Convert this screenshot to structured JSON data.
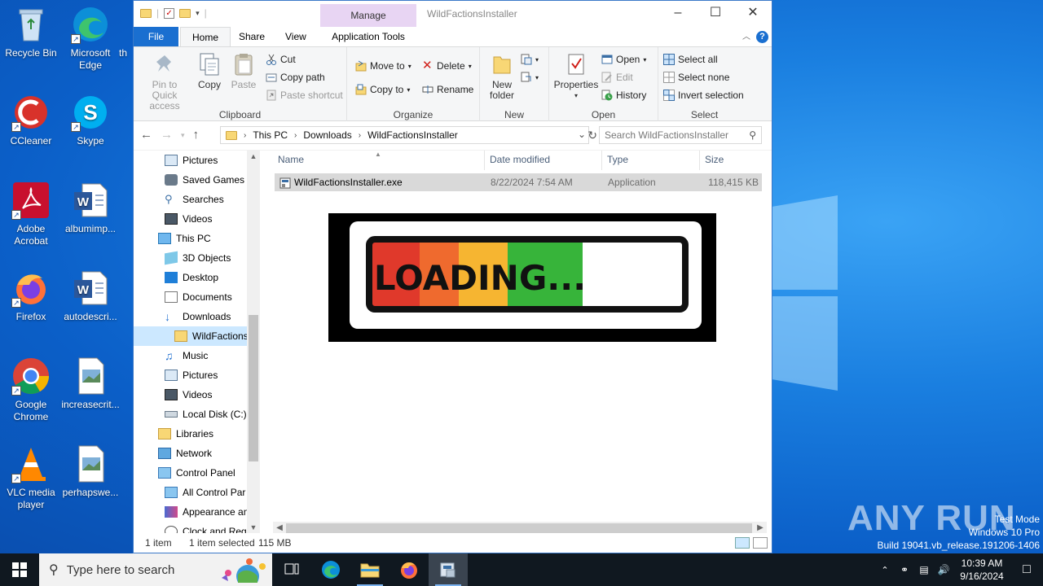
{
  "desktop": {
    "icons": [
      {
        "label": "Recycle Bin",
        "icon": "recycle-bin-icon"
      },
      {
        "label": "Microsoft Edge",
        "icon": "edge-icon"
      },
      {
        "label": "th",
        "icon": "generic-icon"
      },
      {
        "label": "CCleaner",
        "icon": "ccleaner-icon"
      },
      {
        "label": "Skype",
        "icon": "skype-icon"
      },
      {
        "label": "Adobe Acrobat",
        "icon": "acrobat-icon"
      },
      {
        "label": "albumimp...",
        "icon": "word-doc-icon"
      },
      {
        "label": "Firefox",
        "icon": "firefox-icon"
      },
      {
        "label": "autodescri...",
        "icon": "word-doc-icon"
      },
      {
        "label": "Google Chrome",
        "icon": "chrome-icon"
      },
      {
        "label": "increasecrit...",
        "icon": "image-file-icon"
      },
      {
        "label": "VLC media player",
        "icon": "vlc-icon"
      },
      {
        "label": "perhapswe...",
        "icon": "image-file-icon"
      }
    ],
    "watermark": "ANY RUN",
    "test_mode": {
      "line1": "Test Mode",
      "line2": "Windows 10 Pro",
      "line3": "Build 19041.vb_release.191206-1406"
    }
  },
  "window": {
    "title": "WildFactionsInstaller",
    "manage_tab": "Manage",
    "tabs": {
      "file": "File",
      "home": "Home",
      "share": "Share",
      "view": "View",
      "app_tools": "Application Tools"
    },
    "ribbon": {
      "clipboard": {
        "label": "Clipboard",
        "pin": "Pin to Quick access",
        "copy": "Copy",
        "paste": "Paste",
        "cut": "Cut",
        "copy_path": "Copy path",
        "paste_shortcut": "Paste shortcut"
      },
      "organize": {
        "label": "Organize",
        "move_to": "Move to",
        "copy_to": "Copy to",
        "delete": "Delete",
        "rename": "Rename"
      },
      "new": {
        "label": "New",
        "new_folder": "New folder"
      },
      "open": {
        "label": "Open",
        "properties": "Properties",
        "open": "Open",
        "edit": "Edit",
        "history": "History"
      },
      "select": {
        "label": "Select",
        "select_all": "Select all",
        "select_none": "Select none",
        "invert": "Invert selection"
      }
    },
    "address": {
      "crumbs": [
        "This PC",
        "Downloads",
        "WildFactionsInstaller"
      ],
      "search_placeholder": "Search WildFactionsInstaller"
    },
    "nav": [
      {
        "label": "Pictures",
        "icon": "pictures-icon"
      },
      {
        "label": "Saved Games",
        "icon": "saved-games-icon"
      },
      {
        "label": "Searches",
        "icon": "searches-icon"
      },
      {
        "label": "Videos",
        "icon": "videos-icon"
      },
      {
        "label": "This PC",
        "icon": "this-pc-icon"
      },
      {
        "label": "3D Objects",
        "icon": "3d-objects-icon"
      },
      {
        "label": "Desktop",
        "icon": "desktop-icon"
      },
      {
        "label": "Documents",
        "icon": "documents-icon"
      },
      {
        "label": "Downloads",
        "icon": "downloads-icon"
      },
      {
        "label": "WildFactionsI",
        "icon": "folder-icon"
      },
      {
        "label": "Music",
        "icon": "music-icon"
      },
      {
        "label": "Pictures",
        "icon": "pictures-icon"
      },
      {
        "label": "Videos",
        "icon": "videos-icon"
      },
      {
        "label": "Local Disk (C:)",
        "icon": "disk-icon"
      },
      {
        "label": "Libraries",
        "icon": "libraries-icon"
      },
      {
        "label": "Network",
        "icon": "network-icon"
      },
      {
        "label": "Control Panel",
        "icon": "control-panel-icon"
      },
      {
        "label": "All Control Par",
        "icon": "control-panel-icon"
      },
      {
        "label": "Appearance an",
        "icon": "appearance-icon"
      },
      {
        "label": "Clock and Regi",
        "icon": "clock-icon"
      }
    ],
    "columns": {
      "name": "Name",
      "date": "Date modified",
      "type": "Type",
      "size": "Size"
    },
    "files": [
      {
        "name": "WildFactionsInstaller.exe",
        "date": "8/22/2024 7:54 AM",
        "type": "Application",
        "size": "118,415 KB"
      }
    ],
    "loading_text": "LOADING...",
    "status": {
      "count": "1 item",
      "selected": "1 item selected",
      "size": "115 MB"
    }
  },
  "taskbar": {
    "search_placeholder": "Type here to search",
    "time": "10:39 AM",
    "date": "9/16/2024"
  },
  "colors": {
    "accent": "#1a6fd0",
    "manage_tab": "#e8d5f3",
    "selection": "#cce8ff",
    "desktop": "#1a7fe0"
  }
}
